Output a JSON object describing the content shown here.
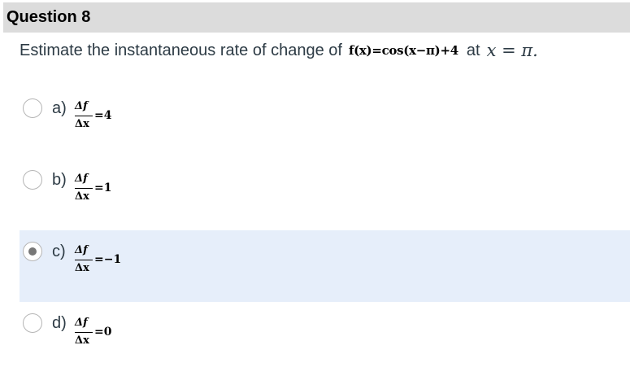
{
  "question": {
    "title": "Question 8",
    "prompt_prefix": "Estimate the instantaneous rate of change of",
    "function_text": "f(x)=cos(x−π)+4",
    "prompt_at": "at",
    "point_text": "x = π."
  },
  "options": [
    {
      "letter": "a)",
      "numerator": "Δf",
      "denominator": "Δx",
      "rhs": "=4",
      "selected": false
    },
    {
      "letter": "b)",
      "numerator": "Δf",
      "denominator": "Δx",
      "rhs": "=1",
      "selected": false
    },
    {
      "letter": "c)",
      "numerator": "Δf",
      "denominator": "Δx",
      "rhs": "=−1",
      "selected": true
    },
    {
      "letter": "d)",
      "numerator": "Δf",
      "denominator": "Δx",
      "rhs": "=0",
      "selected": false
    }
  ],
  "colors": {
    "header_bg": "#dcdcdc",
    "selected_bg": "#e6eefa",
    "text": "#2d3b45"
  }
}
